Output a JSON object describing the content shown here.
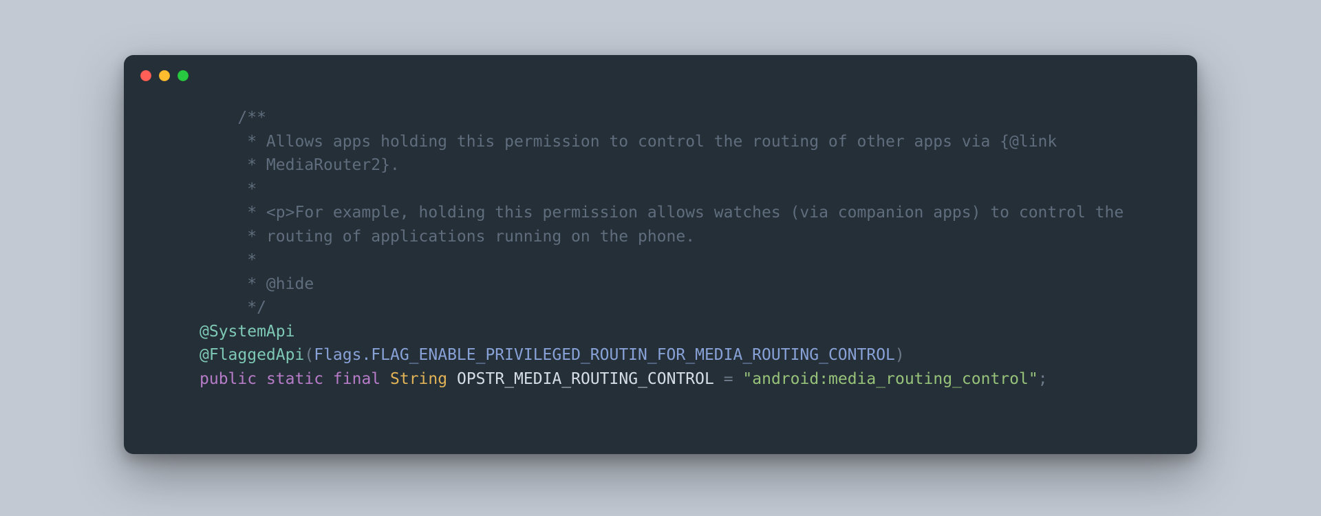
{
  "traffic": {
    "red": "#ff5f57",
    "yellow": "#febc2e",
    "green": "#28c840"
  },
  "code": {
    "comment": {
      "l0": "/**",
      "l1": " * Allows apps holding this permission to control the routing of other apps via {@link",
      "l2": " * MediaRouter2}.",
      "l3": " *",
      "l4": " * <p>For example, holding this permission allows watches (via companion apps) to control the",
      "l5": " * routing of applications running on the phone.",
      "l6": " *",
      "l7": " * @hide",
      "l8": " */"
    },
    "anno1": "@SystemApi",
    "anno2": {
      "name": "@FlaggedApi",
      "open": "(",
      "cls": "Flags",
      "dot": ".",
      "flag": "FLAG_ENABLE_PRIVILEGED_ROUTIN_FOR_MEDIA_ROUTING_CONTROL",
      "close": ")"
    },
    "decl": {
      "kw_public": "public",
      "kw_static": "static",
      "kw_final": "final",
      "type": "String",
      "name": "OPSTR_MEDIA_ROUTING_CONTROL",
      "eq": "=",
      "str": "\"android:media_routing_control\"",
      "semi": ";"
    }
  }
}
